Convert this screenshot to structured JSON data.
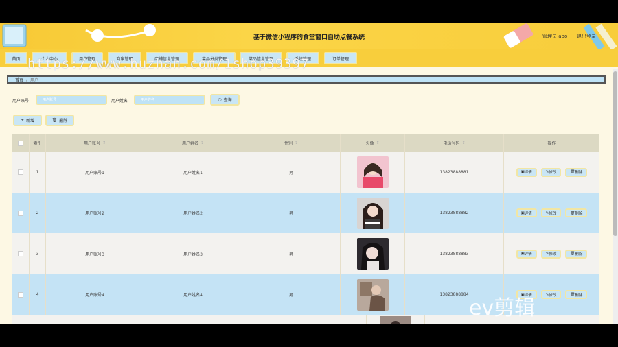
{
  "header": {
    "title": "基于微信小程序的食堂窗口自助点餐系统",
    "admin_text": "管理员 abo",
    "logout_label": "退出登录",
    "colors": {
      "primary": "#f8ce3c",
      "accent": "#bfe3f6"
    }
  },
  "nav": {
    "items": [
      "首页",
      "个人中心",
      "用户管理",
      "商家管理",
      "店铺信息管理",
      "菜品分类管理",
      "菜品信息管理",
      "系统管理",
      "订单管理"
    ]
  },
  "watermark": "https://www.huzhan.com/1shop39397",
  "breadcrumb": {
    "home": "首页",
    "separator": "/",
    "current": "用户"
  },
  "search": {
    "account_label": "用户账号",
    "account_placeholder": "用户账号",
    "name_label": "用户姓名",
    "name_placeholder": "用户姓名",
    "query_label": "查询"
  },
  "actions": {
    "add_label": "新增",
    "delete_label": "删除"
  },
  "table": {
    "columns": [
      "索引",
      "用户账号",
      "用户姓名",
      "性别",
      "头像",
      "电话号码",
      "操作"
    ],
    "sort_icon": "sort-icon",
    "rows": [
      {
        "index": "1",
        "account": "用户账号1",
        "name": "用户姓名1",
        "gender": "男",
        "phone": "13823888881"
      },
      {
        "index": "2",
        "account": "用户账号2",
        "name": "用户姓名2",
        "gender": "男",
        "phone": "13823888882"
      },
      {
        "index": "3",
        "account": "用户账号3",
        "name": "用户姓名3",
        "gender": "男",
        "phone": "13823888883"
      },
      {
        "index": "4",
        "account": "用户账号4",
        "name": "用户姓名4",
        "gender": "男",
        "phone": "13823888884"
      }
    ],
    "op_detail": "详情",
    "op_edit": "修改",
    "op_delete": "删除"
  },
  "overlay_logo": "ev剪辑"
}
